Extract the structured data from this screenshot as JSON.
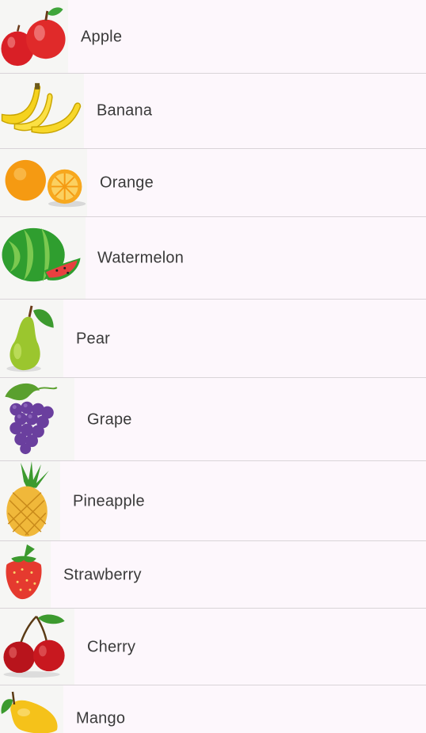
{
  "fruit_list": {
    "items": [
      {
        "name": "Apple",
        "icon": "apple-icon"
      },
      {
        "name": "Banana",
        "icon": "banana-icon"
      },
      {
        "name": "Orange",
        "icon": "orange-icon"
      },
      {
        "name": "Watermelon",
        "icon": "watermelon-icon"
      },
      {
        "name": "Pear",
        "icon": "pear-icon"
      },
      {
        "name": "Grape",
        "icon": "grape-icon"
      },
      {
        "name": "Pineapple",
        "icon": "pineapple-icon"
      },
      {
        "name": "Strawberry",
        "icon": "strawberry-icon"
      },
      {
        "name": "Cherry",
        "icon": "cherry-icon"
      },
      {
        "name": "Mango",
        "icon": "mango-icon"
      }
    ]
  },
  "colors": {
    "background": "#fdf7fc",
    "divider": "#d9d4d8",
    "text": "#3a3a3a"
  }
}
